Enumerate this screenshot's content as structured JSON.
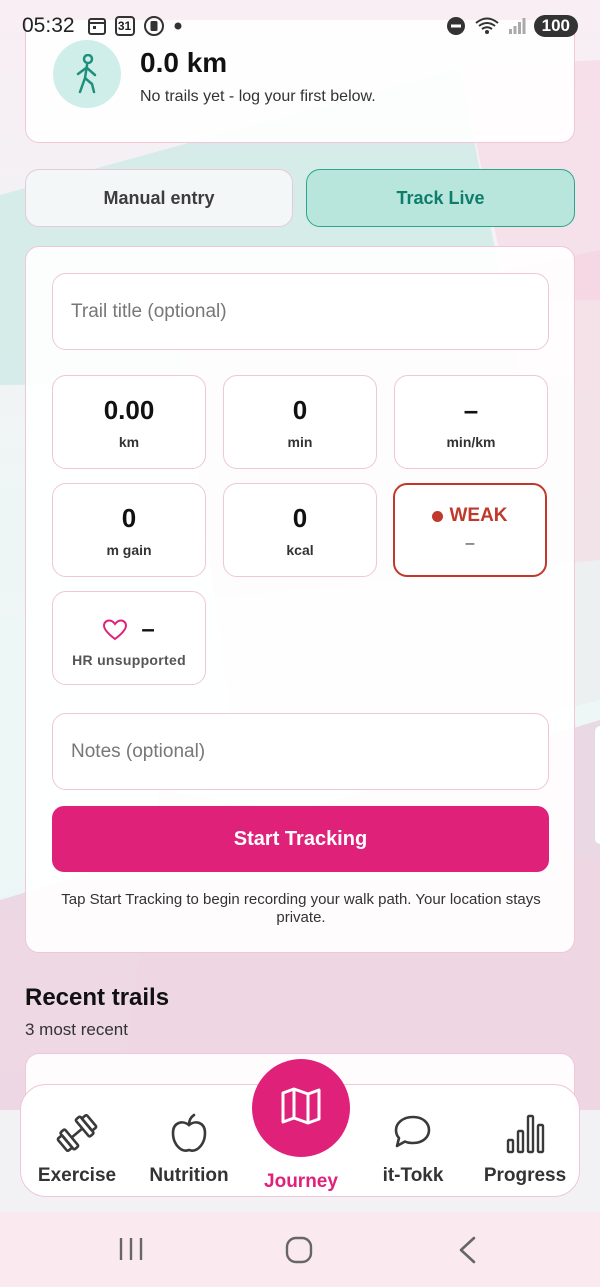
{
  "status_bar": {
    "time": "05:32",
    "calendar_day": "31",
    "battery": "100"
  },
  "summary": {
    "distance": "0.0 km",
    "subtitle": "No trails yet - log your first below."
  },
  "tabs": [
    {
      "label": "Manual entry",
      "active": false
    },
    {
      "label": "Track Live",
      "active": true
    }
  ],
  "form": {
    "title_placeholder": "Trail title (optional)",
    "notes_placeholder": "Notes (optional)"
  },
  "metrics": [
    {
      "value": "0.00",
      "unit": "km"
    },
    {
      "value": "0",
      "unit": "min"
    },
    {
      "value": "–",
      "unit": "min/km"
    },
    {
      "value": "0",
      "unit": "m gain"
    },
    {
      "value": "0",
      "unit": "kcal"
    }
  ],
  "gps": {
    "status": "WEAK",
    "detail": "–"
  },
  "heart_rate": {
    "value": "–",
    "label": "HR unsupported"
  },
  "start_button": "Start Tracking",
  "hint": "Tap Start Tracking to begin recording your walk path. Your location stays private.",
  "recent": {
    "title": "Recent trails",
    "subtitle": "3 most recent"
  },
  "nav": {
    "items": [
      {
        "label": "Exercise",
        "icon": "dumbbell-icon"
      },
      {
        "label": "Nutrition",
        "icon": "apple-icon"
      },
      {
        "label": "Journey",
        "icon": "map-icon",
        "active": true
      },
      {
        "label": "it-Tokk",
        "icon": "chat-icon"
      },
      {
        "label": "Progress",
        "icon": "bar-chart-icon"
      }
    ]
  },
  "colors": {
    "accent_pink": "#e0217a",
    "accent_teal": "#2aa58f",
    "weak_red": "#c0392b"
  }
}
